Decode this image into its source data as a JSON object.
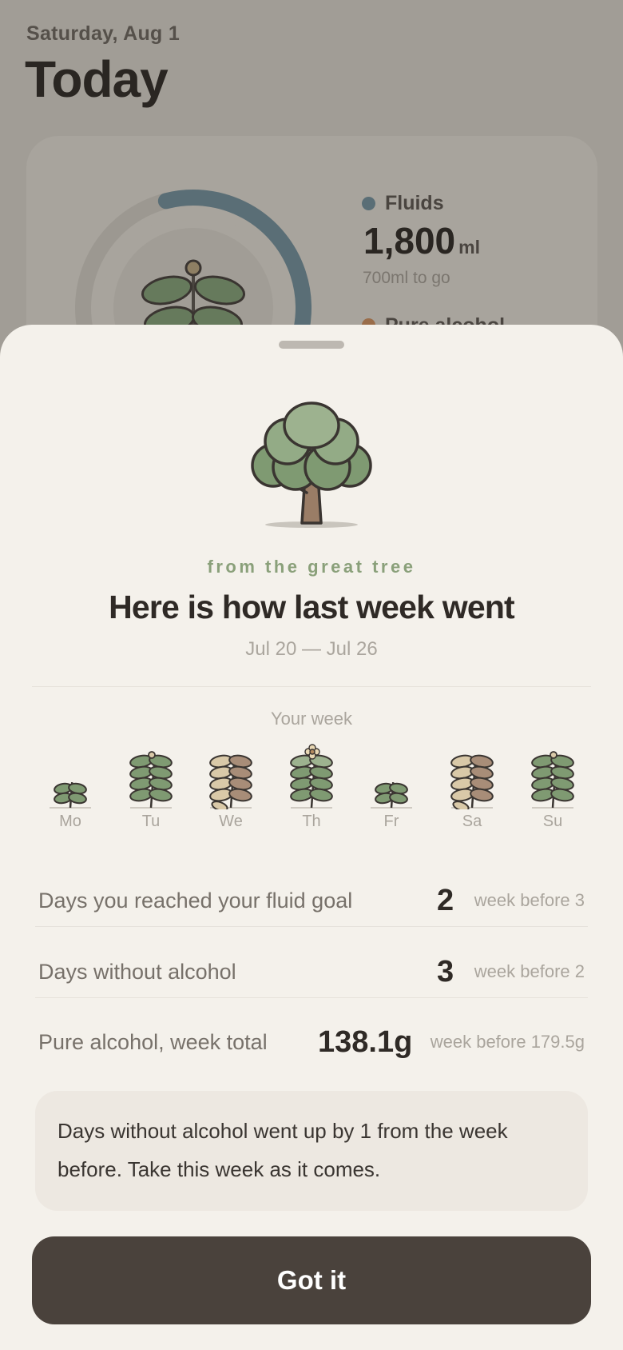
{
  "background": {
    "date": "Saturday, Aug 1",
    "title": "Today",
    "fluids": {
      "label": "Fluids",
      "value": "1,800",
      "unit": "ml",
      "remaining": "700ml to go",
      "progress": 0.72,
      "color": "#5a6e76"
    },
    "alcohol": {
      "label": "Pure alcohol",
      "color": "#9a6d4a"
    }
  },
  "sheet": {
    "eyebrow": "from the great tree",
    "headline": "Here is how last week went",
    "date_range": "Jul 20 — Jul 26",
    "week_label": "Your week",
    "days": [
      {
        "label": "Mo",
        "plant": "small-green-plant-icon"
      },
      {
        "label": "Tu",
        "plant": "green-plant-icon"
      },
      {
        "label": "We",
        "plant": "withered-plant-icon"
      },
      {
        "label": "Th",
        "plant": "flowering-plant-icon"
      },
      {
        "label": "Fr",
        "plant": "small-green-plant-icon"
      },
      {
        "label": "Sa",
        "plant": "withered-plant-icon"
      },
      {
        "label": "Su",
        "plant": "green-plant-icon"
      }
    ],
    "stats": [
      {
        "label": "Days you reached your fluid goal",
        "value": "2",
        "prev": "week before 3"
      },
      {
        "label": "Days without alcohol",
        "value": "3",
        "prev": "week before 2"
      },
      {
        "label": "Pure alcohol, week total",
        "value": "138.1g",
        "prev": "week before 179.5g"
      }
    ],
    "note": "Days without alcohol went up by 1 from the week before. Take this week as it comes.",
    "cta_label": "Got it"
  },
  "colors": {
    "accent_green": "#8aa07a",
    "leaf_green": "#7f9a72",
    "withered_leaf": "#a88d78",
    "button_bg": "#4a423c",
    "sheet_bg": "#f4f1eb"
  }
}
